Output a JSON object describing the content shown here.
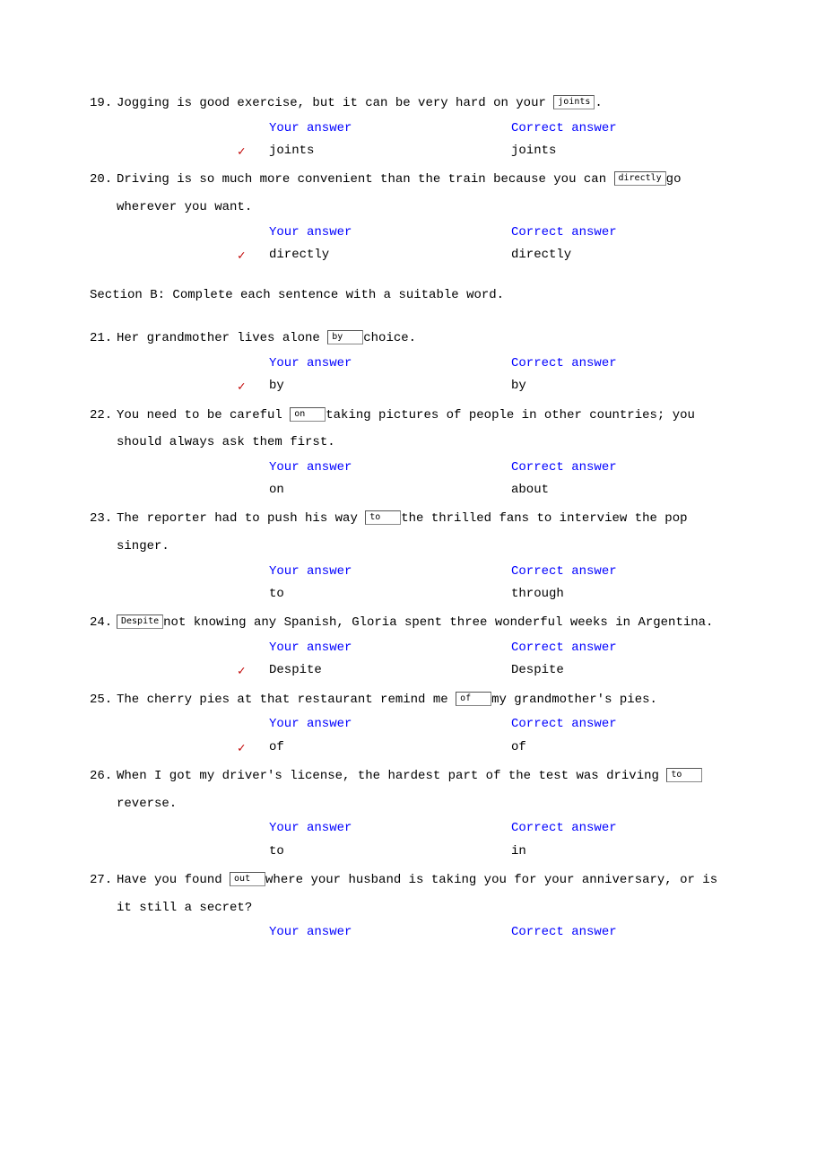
{
  "labels": {
    "your_answer": "Your answer",
    "correct_answer": "Correct answer"
  },
  "section_b_title": "Section B: Complete each sentence with a suitable word.",
  "questions": [
    {
      "num": "19.",
      "seg_a": "Jogging is good exercise, but it can be very hard on your ",
      "input": "joints",
      "seg_b": ".",
      "your": "joints",
      "correct": "joints",
      "mark": true
    },
    {
      "num": "20.",
      "seg_a": "Driving is so much more convenient than the train because you can ",
      "input": "directly",
      "seg_b": "go wherever you want.",
      "your": "directly",
      "correct": "directly",
      "mark": true
    },
    {
      "num": "21.",
      "seg_a": "Her grandmother lives alone ",
      "input": "by",
      "seg_b": "choice.",
      "your": "by",
      "correct": "by",
      "mark": true
    },
    {
      "num": "22.",
      "seg_a": "You need to be careful ",
      "input": "on",
      "seg_b": "taking pictures of people in other countries; you should always ask them first.",
      "your": "on",
      "correct": "about",
      "mark": false
    },
    {
      "num": "23.",
      "seg_a": "The reporter had to push his way ",
      "input": "to",
      "seg_b": "the thrilled fans to interview the pop singer.",
      "your": "to",
      "correct": "through",
      "mark": false
    },
    {
      "num": "24.",
      "seg_a": "",
      "input": "Despite",
      "seg_b": "not knowing any Spanish, Gloria spent three wonderful weeks in Argentina.",
      "your": "Despite",
      "correct": "Despite",
      "mark": true
    },
    {
      "num": "25.",
      "seg_a": "The cherry pies at that restaurant remind me ",
      "input": "of",
      "seg_b": "my grandmother's pies.",
      "your": "of",
      "correct": "of",
      "mark": true
    },
    {
      "num": "26.",
      "seg_a": "When I got my driver's license, the hardest part of the test was driving ",
      "input": "to",
      "seg_b": "reverse.",
      "your": "to",
      "correct": "in",
      "mark": false
    },
    {
      "num": "27.",
      "seg_a": "Have you found ",
      "input": "out",
      "seg_b": "where your husband is taking you for your anniversary, or is it still a secret?",
      "your": "",
      "correct": "",
      "mark": false,
      "header_only": true
    }
  ],
  "section_break_after": 1
}
